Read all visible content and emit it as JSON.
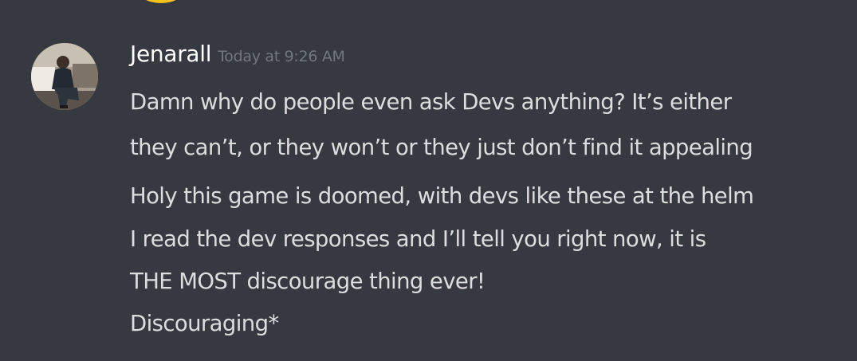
{
  "message": {
    "username": "Jenarall",
    "timestamp": "Today at 9:26 AM",
    "lines": [
      "Damn why do people even ask Devs anything? It’s either",
      "they can’t, or they won’t or they just don’t find it appealing",
      "Holy this game is doomed, with devs like these at the helm",
      "I read the dev responses and I’ll tell you right now, it is",
      "THE MOST discourage thing ever!",
      "Discouraging*"
    ]
  },
  "colors": {
    "background": "#36393f",
    "username": "#ffffff",
    "timestamp": "#72767d",
    "message_text": "#dcddde",
    "previous_avatar": "#f8c21c"
  }
}
